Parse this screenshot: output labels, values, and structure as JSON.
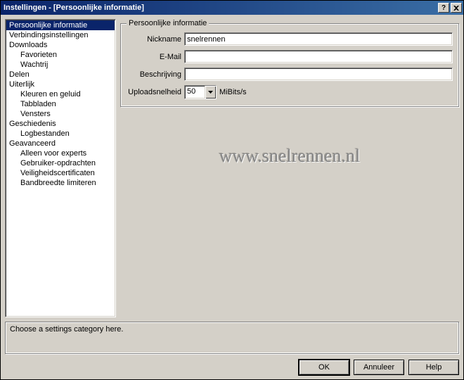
{
  "window": {
    "title": "Instellingen - [Persoonlijke informatie]"
  },
  "sidebar": {
    "items": [
      {
        "label": "Persoonlijke informatie",
        "selected": true,
        "child": false
      },
      {
        "label": "Verbindingsinstellingen",
        "selected": false,
        "child": false
      },
      {
        "label": "Downloads",
        "selected": false,
        "child": false
      },
      {
        "label": "Favorieten",
        "selected": false,
        "child": true
      },
      {
        "label": "Wachtrij",
        "selected": false,
        "child": true
      },
      {
        "label": "Delen",
        "selected": false,
        "child": false
      },
      {
        "label": "Uiterlijk",
        "selected": false,
        "child": false
      },
      {
        "label": "Kleuren en geluid",
        "selected": false,
        "child": true
      },
      {
        "label": "Tabbladen",
        "selected": false,
        "child": true
      },
      {
        "label": "Vensters",
        "selected": false,
        "child": true
      },
      {
        "label": "Geschiedenis",
        "selected": false,
        "child": false
      },
      {
        "label": "Logbestanden",
        "selected": false,
        "child": true
      },
      {
        "label": "Geavanceerd",
        "selected": false,
        "child": false
      },
      {
        "label": "Alleen voor experts",
        "selected": false,
        "child": true
      },
      {
        "label": "Gebruiker-opdrachten",
        "selected": false,
        "child": true
      },
      {
        "label": "Veiligheidscertificaten",
        "selected": false,
        "child": true
      },
      {
        "label": "Bandbreedte limiteren",
        "selected": false,
        "child": true
      }
    ]
  },
  "group": {
    "legend": "Persoonlijke informatie",
    "nickname_label": "Nickname",
    "nickname_value": "snelrennen",
    "email_label": "E-Mail",
    "email_value": "",
    "desc_label": "Beschrijving",
    "desc_value": "",
    "upload_label": "Uploadsnelheid",
    "upload_value": "50",
    "upload_unit": "MiBits/s"
  },
  "watermark": "www.snelrennen.nl",
  "hint": "Choose a settings category here.",
  "footer": {
    "ok": "OK",
    "cancel": "Annuleer",
    "help": "Help"
  }
}
